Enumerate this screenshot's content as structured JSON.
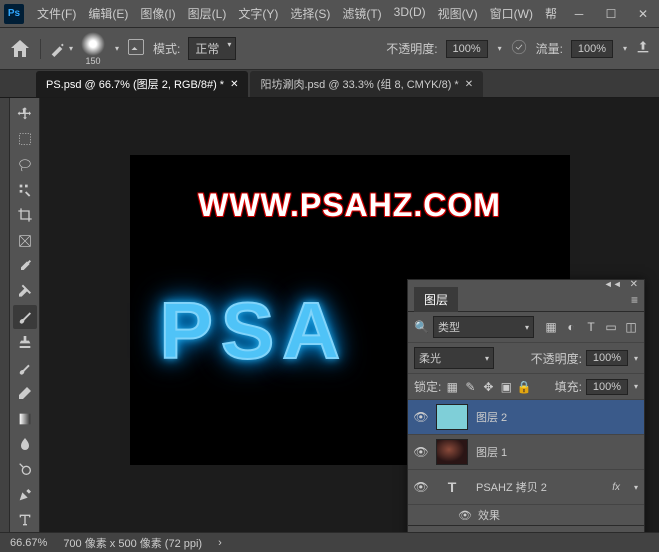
{
  "menu": {
    "file": "文件(F)",
    "edit": "编辑(E)",
    "image": "图像(I)",
    "layer": "图层(L)",
    "text": "文字(Y)",
    "select": "选择(S)",
    "filter": "滤镜(T)",
    "three_d": "3D(D)",
    "view": "视图(V)",
    "window": "窗口(W)",
    "help": "帮"
  },
  "optbar": {
    "brush_size": "150",
    "mode_label": "模式:",
    "mode_value": "正常",
    "opacity_label": "不透明度:",
    "opacity_value": "100%",
    "flow_label": "流量:",
    "flow_value": "100%"
  },
  "tabs": {
    "active": "PS.psd @ 66.7% (图层 2, RGB/8#) *",
    "inactive": "阳坊涮肉.psd @ 33.3% (组 8, CMYK/8) *"
  },
  "canvas": {
    "url": "WWW.PSAHZ.COM",
    "main_text": "PSA"
  },
  "panel": {
    "title": "图层",
    "type_label": "类型",
    "blend_mode": "柔光",
    "opacity_label": "不透明度:",
    "opacity_value": "100%",
    "lock_label": "锁定:",
    "fill_label": "填充:",
    "fill_value": "100%",
    "layers": [
      {
        "name": "图层 2",
        "type": "solid"
      },
      {
        "name": "图层 1",
        "type": "img"
      },
      {
        "name": "PSAHZ 拷贝 2",
        "type": "text",
        "fx": true
      }
    ],
    "effects_label": "效果"
  },
  "status": {
    "zoom": "66.67%",
    "dims": "700 像素 x 500 像素 (72 ppi)"
  }
}
